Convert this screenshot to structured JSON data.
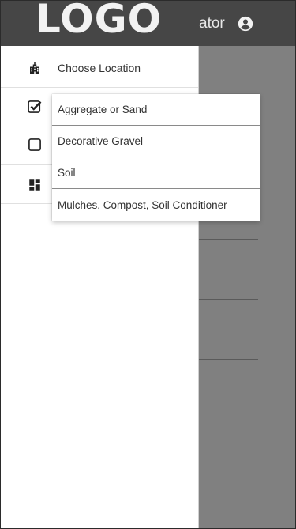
{
  "appbar": {
    "logo": "LOGO",
    "title_partial": "ator",
    "account_icon": "account-circle-icon"
  },
  "drawer": {
    "items": [
      {
        "icon": "city-icon",
        "label": "Choose Location"
      },
      {
        "icon": "checkbox-checked-icon",
        "label": ""
      },
      {
        "icon": "checkbox-empty-icon",
        "label": ""
      },
      {
        "icon": "dashboard-icon",
        "label": ""
      }
    ]
  },
  "menu": {
    "options": [
      "Aggregate or Sand",
      "Decorative Gravel",
      "Soil",
      "Mulches, Compost, Soil Conditioner"
    ]
  },
  "colors": {
    "appbar": "#464646",
    "scrim": "#808080",
    "drawer": "#ffffff"
  }
}
